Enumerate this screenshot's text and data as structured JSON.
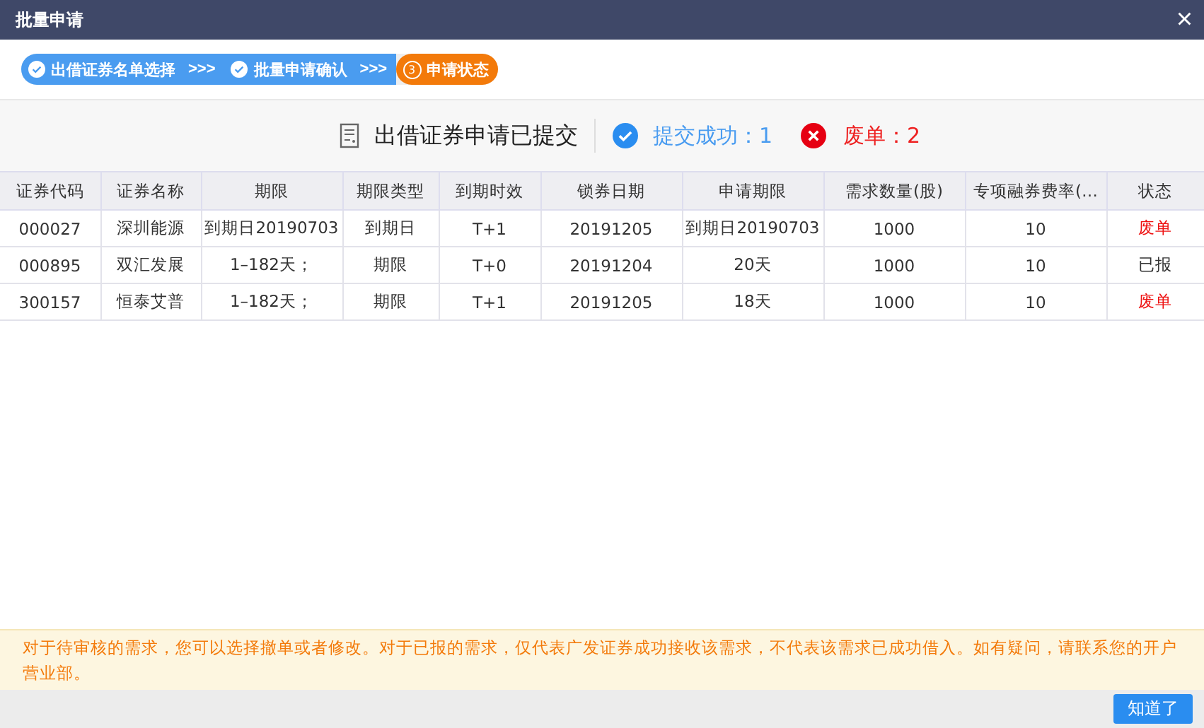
{
  "window": {
    "title": "批量申请",
    "close": "×"
  },
  "steps": [
    {
      "label": "出借证券名单选择",
      "done": true,
      "selected": false,
      "separator": ">>>"
    },
    {
      "label": "批量申请确认",
      "done": true,
      "selected": false,
      "separator": ">>>"
    },
    {
      "label": "申请状态",
      "done": false,
      "selected": true,
      "number": "3"
    }
  ],
  "summary": {
    "title": "出借证券申请已提交",
    "success": "提交成功：1",
    "failed": "废单：2"
  },
  "table": {
    "columns": [
      "证券代码",
      "证券名称",
      "期限",
      "期限类型",
      "到期时效",
      "锁券日期",
      "申请期限",
      "需求数量(股)",
      "专项融券费率(…",
      "状态"
    ],
    "rows": [
      {
        "cells": [
          "000027",
          "深圳能源",
          "到期日20190703",
          "到期日",
          "T+1",
          "20191205",
          "到期日20190703",
          "1000",
          "10"
        ],
        "status": {
          "text": "废单",
          "color": "#ee1111"
        }
      },
      {
        "cells": [
          "000895",
          "双汇发展",
          "1–182天；",
          "期限",
          "T+0",
          "20191204",
          "20天",
          "1000",
          "10"
        ],
        "status": {
          "text": "已报",
          "color": "#333333"
        }
      },
      {
        "cells": [
          "300157",
          "恒泰艾普",
          "1–182天；",
          "期限",
          "T+1",
          "20191205",
          "18天",
          "1000",
          "10"
        ],
        "status": {
          "text": "废单",
          "color": "#ee1111"
        }
      }
    ]
  },
  "notice": "对于待审核的需求，您可以选择撤单或者修改。对于已报的需求，仅代表广发证券成功接收该需求，不代表该需求已成功借入。如有疑问，请联系您的开户营业部。",
  "confirm_button": "知道了"
}
